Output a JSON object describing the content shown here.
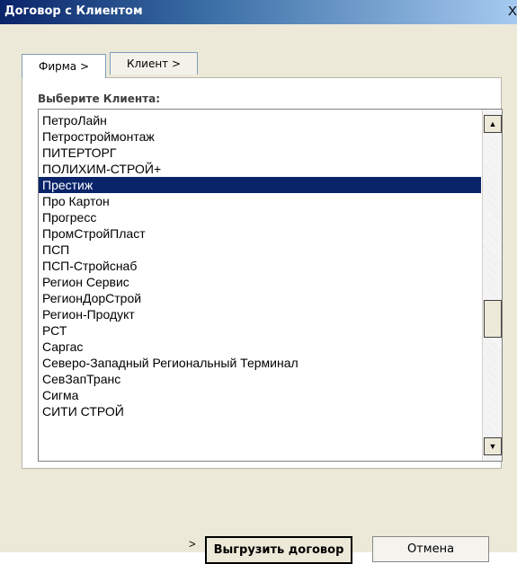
{
  "window": {
    "title": "Договор с Клиентом",
    "close_glyph": "X"
  },
  "tabs": [
    {
      "label": "Фирма >"
    },
    {
      "label": "Клиент >"
    }
  ],
  "list_label": "Выберите Клиента:",
  "clients": [
    "ПетроЛайн",
    "Петростроймонтаж",
    "ПИТЕРТОРГ",
    "ПОЛИХИМ-СТРОЙ+",
    "Престиж",
    "Про Картон",
    "Прогресс",
    "ПромСтройПласт",
    "ПСП",
    "ПСП-Стройснаб",
    "Регион Сервис",
    "РегионДорСтрой",
    "Регион-Продукт",
    "РСТ",
    "Саргас",
    "Северо-Западный Региональный Терминал",
    "СевЗапТранс",
    "Сигма",
    "СИТИ СТРОЙ"
  ],
  "selected_client": "Престиж",
  "scrollbar": {
    "up_icon": "triangle-up-icon",
    "down_icon": "triangle-down-icon",
    "up_glyph": "▲",
    "down_glyph": "▼"
  },
  "footer": {
    "arrow": ">",
    "export_label": "Выгрузить договор",
    "cancel_label": "Отмена"
  },
  "colors": {
    "selection": "#0a246a",
    "titlebar_start": "#0a246a",
    "titlebar_end": "#a6caf0"
  }
}
